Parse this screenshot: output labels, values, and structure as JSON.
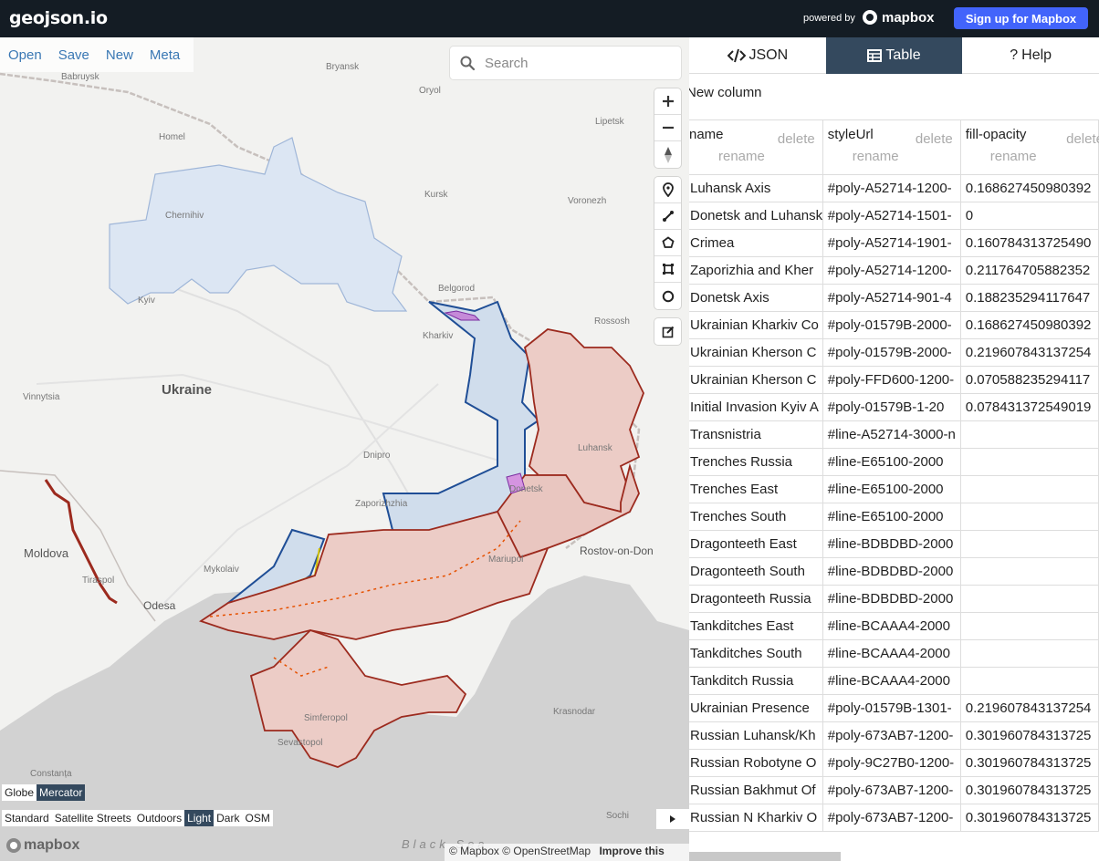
{
  "app": {
    "title": "geojson.io"
  },
  "header": {
    "powered_by": "powered by",
    "mapbox_label": "mapbox",
    "signup_label": "Sign up for Mapbox"
  },
  "file_menu": {
    "open": "Open",
    "save": "Save",
    "new": "New",
    "meta": "Meta"
  },
  "search": {
    "placeholder": "Search"
  },
  "map": {
    "places": {
      "bryansk": "Bryansk",
      "babruysk": "Babruysk",
      "oryol": "Oryol",
      "lipetsk": "Lipetsk",
      "homel": "Homel",
      "chernihiv": "Chernihiv",
      "kursk": "Kursk",
      "voronezh": "Voronezh",
      "kyiv": "Kyiv",
      "belgorod": "Belgorod",
      "kharkiv": "Kharkiv",
      "rossosh": "Rossosh",
      "vinnytsia": "Vinnytsia",
      "ukraine": "Ukraine",
      "luhansk": "Luhansk",
      "dnipro": "Dnipro",
      "zaporizhzhia": "Zaporizhzhia",
      "donetsk": "Donetsk",
      "moldova": "Moldova",
      "mykolaiv": "Mykolaiv",
      "mariupol": "Mariupol",
      "rostov": "Rostov-on-Don",
      "odesa": "Odesa",
      "tiraspol": "Tiraspol",
      "simferopol": "Simferopol",
      "sevastopol": "Sevastopol",
      "krasnodar": "Krasnodar",
      "constanta": "Constanța",
      "sochi": "Sochi"
    },
    "sea_label": "Black Sea",
    "projections": [
      "Globe",
      "Mercator"
    ],
    "active_projection": "Mercator",
    "styles": [
      "Standard",
      "Satellite Streets",
      "Outdoors",
      "Light",
      "Dark",
      "OSM"
    ],
    "active_style": "Light",
    "watermark": "mapbox",
    "attribution": {
      "mapbox": "© Mapbox",
      "osm": "© OpenStreetMap",
      "improve": "Improve this map"
    },
    "colors": {
      "blue_fill": "#cfdcec",
      "blue_stroke": "#1f4e96",
      "red_fill": "#ecccc6",
      "red_stroke": "#9c2a1e"
    }
  },
  "pane": {
    "tabs": [
      {
        "label": "JSON",
        "icon": "code-icon"
      },
      {
        "label": "Table",
        "icon": "table-icon"
      },
      {
        "label": "Help",
        "icon": "question-icon"
      }
    ],
    "active_tab": "Table",
    "new_column": "New column",
    "columns": [
      {
        "name": "name",
        "delete": "delete",
        "rename": "rename"
      },
      {
        "name": "styleUrl",
        "delete": "delete",
        "rename": "rename"
      },
      {
        "name": "fill-opacity",
        "delete": "delete",
        "rename": "rename"
      }
    ],
    "rows": [
      [
        "Luhansk Axis",
        "#poly-A52714-1200-",
        "0.168627450980392"
      ],
      [
        "Donetsk and Luhansk",
        "#poly-A52714-1501-",
        "0"
      ],
      [
        "Crimea",
        "#poly-A52714-1901-",
        "0.160784313725490"
      ],
      [
        "Zaporizhia and Kher",
        "#poly-A52714-1200-",
        "0.211764705882352"
      ],
      [
        "Donetsk Axis",
        "#poly-A52714-901-4",
        "0.188235294117647"
      ],
      [
        "Ukrainian Kharkiv Co",
        "#poly-01579B-2000-",
        "0.168627450980392"
      ],
      [
        "Ukrainian Kherson C",
        "#poly-01579B-2000-",
        "0.219607843137254"
      ],
      [
        "Ukrainian Kherson C",
        "#poly-FFD600-1200-",
        "0.070588235294117"
      ],
      [
        "Initial Invasion Kyiv A",
        "#poly-01579B-1-20",
        "0.078431372549019"
      ],
      [
        "Transnistria",
        "#line-A52714-3000-n",
        ""
      ],
      [
        "Trenches Russia",
        "#line-E65100-2000",
        ""
      ],
      [
        "Trenches East",
        "#line-E65100-2000",
        ""
      ],
      [
        "Trenches South",
        "#line-E65100-2000",
        ""
      ],
      [
        "Dragonteeth East",
        "#line-BDBDBD-2000",
        ""
      ],
      [
        "Dragonteeth South",
        "#line-BDBDBD-2000",
        ""
      ],
      [
        "Dragonteeth Russia",
        "#line-BDBDBD-2000",
        ""
      ],
      [
        "Tankditches East",
        "#line-BCAAA4-2000",
        ""
      ],
      [
        "Tankditches South",
        "#line-BCAAA4-2000",
        ""
      ],
      [
        "Tankditch Russia",
        "#line-BCAAA4-2000",
        ""
      ],
      [
        "Ukrainian Presence",
        "#poly-01579B-1301-",
        "0.219607843137254"
      ],
      [
        "Russian Luhansk/Kh",
        "#poly-673AB7-1200-",
        "0.301960784313725"
      ],
      [
        "Russian Robotyne O",
        "#poly-9C27B0-1200-",
        "0.301960784313725"
      ],
      [
        "Russian Bakhmut Of",
        "#poly-673AB7-1200-",
        "0.301960784313725"
      ],
      [
        "Russian N Kharkiv O",
        "#poly-673AB7-1200-",
        "0.301960784313725"
      ]
    ]
  }
}
